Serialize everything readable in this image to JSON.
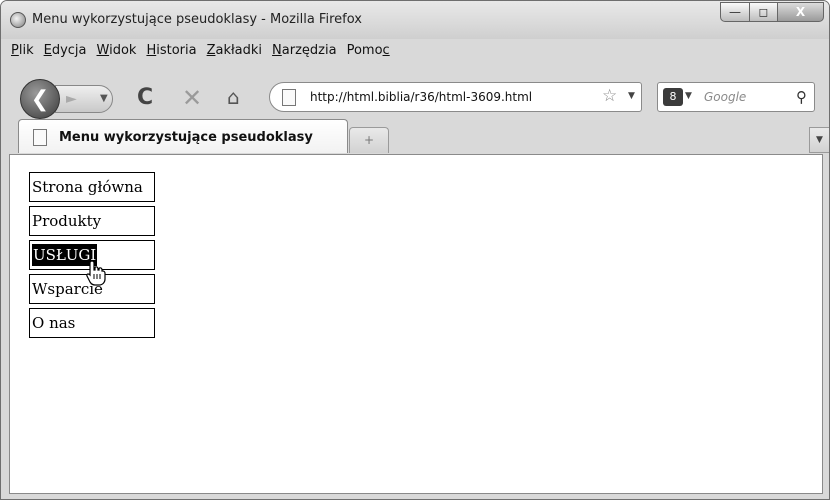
{
  "window": {
    "title": "Menu wykorzystujące pseudoklasy - Mozilla Firefox"
  },
  "menubar": {
    "items": [
      {
        "mnemonic": "P",
        "rest": "lik"
      },
      {
        "mnemonic": "E",
        "rest": "dycja"
      },
      {
        "mnemonic": "W",
        "rest": "idok"
      },
      {
        "mnemonic": "H",
        "rest": "istoria"
      },
      {
        "mnemonic": "Z",
        "rest": "akładki"
      },
      {
        "mnemonic": "N",
        "rest": "arzędzia"
      },
      {
        "prefix": "Pomo",
        "mnemonic": "c",
        "rest": ""
      }
    ]
  },
  "toolbar": {
    "url": "http://html.biblia/r36/html-3609.html",
    "search_placeholder": "Google"
  },
  "tab": {
    "label": "Menu wykorzystujące pseudoklasy",
    "new_tab_symbol": "+"
  },
  "content": {
    "menu": [
      {
        "label": "Strona główna",
        "hover": false
      },
      {
        "label": "Produkty",
        "hover": false
      },
      {
        "label": "USŁUGI",
        "hover": true
      },
      {
        "label": "Wsparcie",
        "hover": false
      },
      {
        "label": "O nas",
        "hover": false
      }
    ]
  },
  "icons": {
    "app": "firefox-icon",
    "back": "back-arrow-icon",
    "forward": "forward-arrow-icon",
    "reload": "reload-icon",
    "stop": "stop-icon",
    "home": "home-icon",
    "bookmark": "star-icon",
    "search_engine": "google-icon",
    "search": "magnify-icon",
    "cursor": "hand-cursor-icon"
  }
}
